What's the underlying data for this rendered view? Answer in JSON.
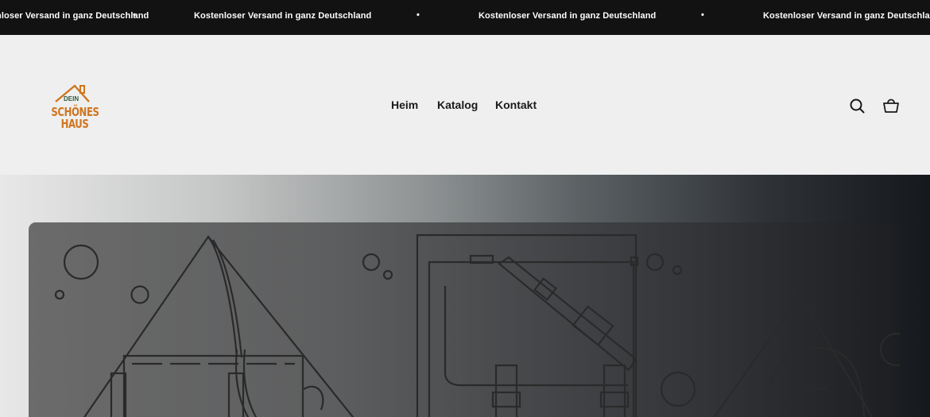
{
  "announcement": {
    "message": "Kostenloser Versand in ganz Deutschland",
    "separator": "•"
  },
  "header": {
    "logo": {
      "top": "DEIN",
      "line1": "SCHÖNES",
      "line2": "HAUS"
    },
    "nav": [
      {
        "label": "Heim"
      },
      {
        "label": "Katalog"
      },
      {
        "label": "Kontakt"
      }
    ],
    "icons": [
      "search-icon",
      "cart-icon"
    ]
  },
  "colors": {
    "announcement_bg": "#121212",
    "header_bg": "#efefef",
    "logo_orange": "#d0751f",
    "logo_green": "#2e5a3a",
    "nav_text": "#1a1a1a"
  }
}
